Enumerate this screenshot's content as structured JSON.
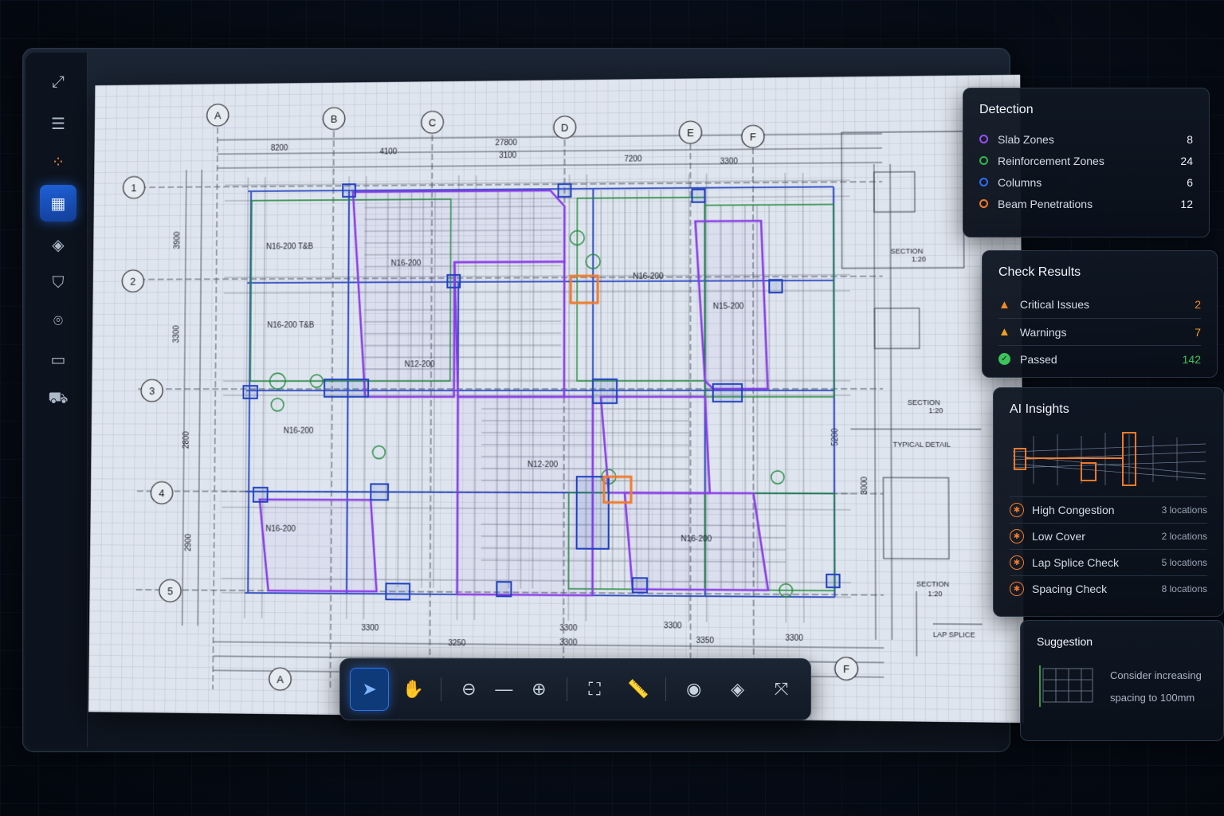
{
  "rail": {
    "items": [
      {
        "name": "measure-tool-icon",
        "glyph": "⤢"
      },
      {
        "name": "list-menu-icon",
        "glyph": "☰"
      },
      {
        "name": "nodes-icon",
        "glyph": "⁘"
      },
      {
        "name": "grid-view-icon",
        "glyph": "▦"
      },
      {
        "name": "layers-icon",
        "glyph": "◈"
      },
      {
        "name": "shield-icon",
        "glyph": "⛉"
      },
      {
        "name": "scan-icon",
        "glyph": "⌾"
      },
      {
        "name": "comment-icon",
        "glyph": "▭"
      },
      {
        "name": "truck-icon",
        "glyph": "⛟"
      }
    ]
  },
  "blueprint": {
    "grid_columns": [
      "A",
      "B",
      "C",
      "D",
      "E",
      "F"
    ],
    "grid_rows": [
      "1",
      "2",
      "3",
      "4",
      "5"
    ],
    "bottom_labels": [
      "A",
      "F"
    ],
    "dimensions_top": [
      "8200",
      "4100",
      "27800",
      "3100",
      "7200",
      "3300"
    ],
    "dimensions_bottom": [
      "3300",
      "3300",
      "3300",
      "3350",
      "3300",
      "3250",
      "3300"
    ],
    "dimensions_left": [
      "3900",
      "3300",
      "2800",
      "2900"
    ],
    "dimensions_right": [
      "5200",
      "3000"
    ],
    "slab_labels": [
      "N16-200 T&B",
      "N16-200",
      "N16-200 T&B",
      "N12-200",
      "N16-200",
      "N12-200",
      "N16-200",
      "N15-200",
      "N16-200",
      "N16-200"
    ],
    "section_labels": [
      "SECTION",
      "SECTION",
      "TYPICAL DETAIL",
      "SECTION",
      "LAP SPLICE"
    ],
    "section_scales": [
      "1:20",
      "1:20",
      "1:20"
    ]
  },
  "toolbar": {
    "tools": [
      {
        "name": "select-tool-icon",
        "glyph": "➤",
        "active": true
      },
      {
        "name": "pan-tool-icon",
        "glyph": "✋",
        "active": false
      },
      {
        "name": "zoom-out-icon",
        "glyph": "⊖",
        "active": false
      },
      {
        "name": "zoom-slider-icon",
        "glyph": "—",
        "active": false
      },
      {
        "name": "zoom-in-icon",
        "glyph": "⊕",
        "active": false
      },
      {
        "name": "fit-view-icon",
        "glyph": "⛶",
        "active": false
      },
      {
        "name": "ruler-icon",
        "glyph": "📏",
        "active": false
      },
      {
        "name": "eye-icon",
        "glyph": "◉",
        "active": false
      },
      {
        "name": "layers-toggle-icon",
        "glyph": "◈",
        "active": false
      },
      {
        "name": "fullscreen-icon",
        "glyph": "⤧",
        "active": false
      }
    ]
  },
  "detection": {
    "title": "Detection",
    "items": [
      {
        "label": "Slab Zones",
        "value": "8",
        "color": "#9b4dff"
      },
      {
        "label": "Reinforcement Zones",
        "value": "24",
        "color": "#2fb84a"
      },
      {
        "label": "Columns",
        "value": "6",
        "color": "#2e6cff"
      },
      {
        "label": "Beam Penetrations",
        "value": "12",
        "color": "#f07a2a"
      }
    ]
  },
  "check_results": {
    "title": "Check Results",
    "items": [
      {
        "label": "Critical Issues",
        "value": "2",
        "color": "#f08a2a",
        "icon": "warning-icon"
      },
      {
        "label": "Warnings",
        "value": "7",
        "color": "#f0a020",
        "icon": "warning-icon"
      },
      {
        "label": "Passed",
        "value": "142",
        "color": "#3cc45a",
        "icon": "check-icon"
      }
    ]
  },
  "ai_insights": {
    "title": "AI Insights",
    "items": [
      {
        "label": "High Congestion",
        "locations": "3 locations"
      },
      {
        "label": "Low Cover",
        "locations": "2 locations"
      },
      {
        "label": "Lap Splice Check",
        "locations": "5 locations"
      },
      {
        "label": "Spacing Check",
        "locations": "8 locations"
      }
    ]
  },
  "suggestion": {
    "title": "Suggestion",
    "line1": "Consider increasing",
    "line2": "spacing to 100mm"
  }
}
